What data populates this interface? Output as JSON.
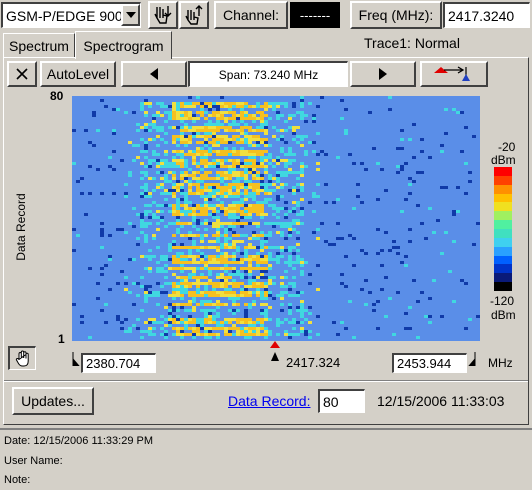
{
  "toolbar": {
    "standard": "GSM-P/EDGE 900",
    "channel_label": "Channel:",
    "channel_value": "-------",
    "freq_label": "Freq (MHz):",
    "freq_value": "2417.3240"
  },
  "tabs": [
    {
      "label": "Spectrum",
      "active": false
    },
    {
      "label": "Spectrogram",
      "active": true
    }
  ],
  "trace_status": "Trace1: Normal",
  "controls": {
    "close_label": "✕",
    "autolevel_label": "AutoLevel",
    "span_label": "Span: 73.240 MHz"
  },
  "chart_data": {
    "type": "heatmap",
    "ylabel": "Data Record",
    "ylim": [
      1,
      80
    ],
    "y_ticks": [
      "80",
      "1"
    ],
    "x_start": "2380.704",
    "x_center": "2417.324",
    "x_stop": "2453.944",
    "x_unit": "MHz",
    "colorbar": {
      "max_label": "-20",
      "max_unit": "dBm",
      "min_label": "-120",
      "min_unit": "dBm",
      "range_dbm": [
        -120,
        -20
      ],
      "colors": [
        "#000000",
        "#0a1a78",
        "#0033c8",
        "#0060ff",
        "#2aa0ff",
        "#3fd0f0",
        "#40e0c0",
        "#50f0a0",
        "#a0f060",
        "#f0e020",
        "#ffc000",
        "#ff9000",
        "#ff4000",
        "#ff0000"
      ]
    },
    "background_color": "#5a8ee8",
    "noise_color": "#103aa8",
    "signal_colors": {
      "strong": "#f5c020",
      "mid": "#f0e040",
      "weak": "#40d8e0"
    }
  },
  "bottom": {
    "updates_label": "Updates...",
    "data_record_label": "Data Record:",
    "data_record_value": "80",
    "timestamp": "12/15/2006 11:33:03"
  },
  "info": {
    "date_line": "Date: 12/15/2006 11:33:29 PM",
    "user_line": "User Name:",
    "note_line": "Note:"
  }
}
